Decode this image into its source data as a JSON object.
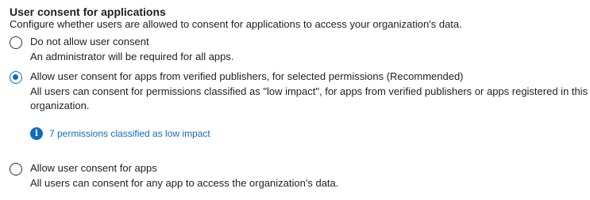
{
  "section": {
    "title": "User consent for applications",
    "description": "Configure whether users are allowed to consent for applications to access your organization's data."
  },
  "options": [
    {
      "label": "Do not allow user consent",
      "description": "An administrator will be required for all apps.",
      "selected": false
    },
    {
      "label": "Allow user consent for apps from verified publishers, for selected permissions (Recommended)",
      "description": "All users can consent for permissions classified as \"low impact\", for apps from verified publishers or apps registered in this organization.",
      "selected": true
    },
    {
      "label": "Allow user consent for apps",
      "description": "All users can consent for any app to access the organization's data.",
      "selected": false
    }
  ],
  "info": {
    "icon": "info-icon",
    "link_text": "7 permissions classified as low impact"
  },
  "colors": {
    "accent": "#0f6cbd",
    "text": "#201f1e"
  }
}
